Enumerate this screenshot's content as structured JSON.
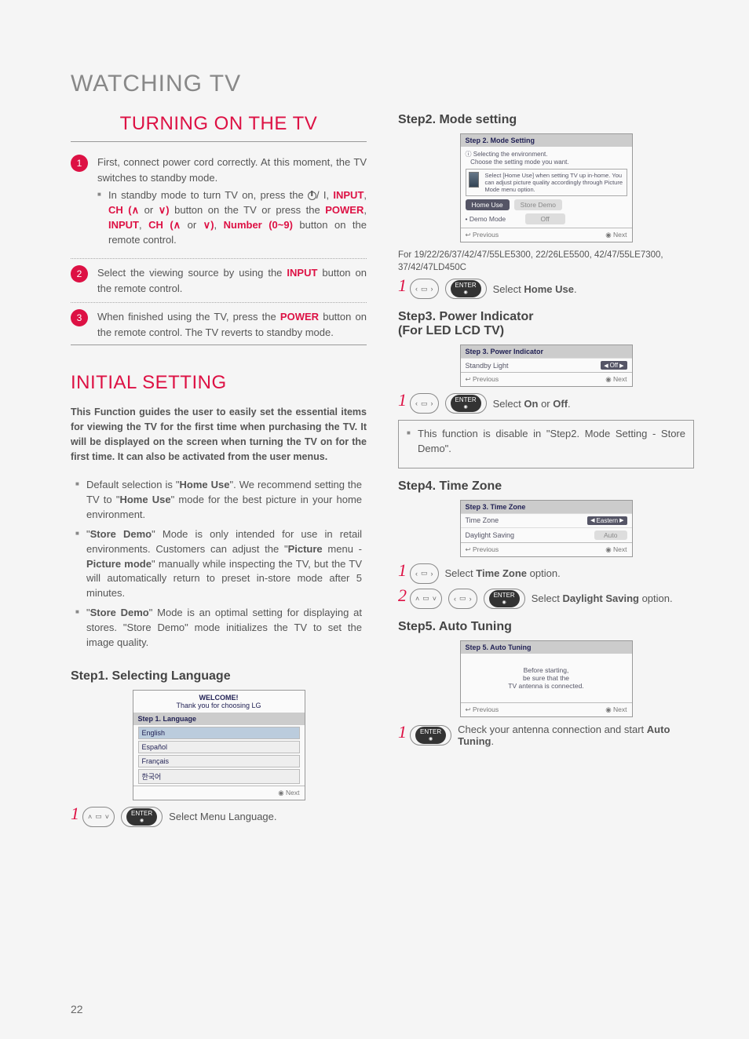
{
  "page": {
    "number": "22",
    "title": "WATCHING TV"
  },
  "turning_on": {
    "title": "TURNING ON THE TV",
    "s1": {
      "line1": "First, connect power cord correctly.",
      "line2": "At this moment, the TV switches to standby mode.",
      "bullet_pre": "In standby mode to turn TV on, press the ",
      "bullet_mid1": "/ I, ",
      "input": "INPUT",
      "comma1": ", ",
      "ch": "CH (",
      "up": "∧",
      "or": " or ",
      "down": "∨",
      "chclose": ")",
      "bullet_mid2": " button on the TV or press the ",
      "power": "POWER",
      "comma2": ", ",
      "num": "Number (0~9)",
      "bullet_end": " button on the remote control."
    },
    "s2": {
      "pre": "Select the viewing source by using the ",
      "input": "INPUT",
      "post": " button on the remote control."
    },
    "s3": {
      "pre": "When finished using the TV, press the ",
      "power": "POWER",
      "post": " button on the remote control. The TV reverts to standby mode."
    }
  },
  "initial": {
    "title": "INITIAL SETTING",
    "intro": "This Function guides the user to easily set the essential items for viewing the TV for the first time when purchasing the TV. It will be displayed on the screen when turning the TV on for the first time. It can also be activated from the user menus.",
    "b1_pre": "Default selection is \"",
    "home_use": "Home Use",
    "b1_mid": "\". We recommend setting the TV to \"",
    "b1_post": "\" mode for the best picture in your home environment.",
    "b2_pre": "\"",
    "store_demo": "Store Demo",
    "b2_mid": "\" Mode is only intended for use in retail environments. Customers can adjust the \"",
    "picture": "Picture",
    "b2_mid2": " menu - ",
    "picture_mode": "Picture mode",
    "b2_post": "\" manually while inspecting the TV, but the TV will automatically return to preset in-store mode after 5 minutes.",
    "b3_pre": "\"",
    "b3_post": "\" Mode is an optimal setting for displaying at stores. \"Store Demo\" mode initializes the TV to set the image quality."
  },
  "step1": {
    "title": "Step1. Selecting Language",
    "osd": {
      "welcome1": "WELCOME!",
      "welcome2": "Thank you for choosing LG",
      "header": "Step 1. Language",
      "opts": [
        "English",
        "Español",
        "Français",
        "한국어"
      ],
      "next": "Next"
    },
    "instr": "Select Menu Language."
  },
  "step2": {
    "title": "Step2. Mode setting",
    "osd": {
      "header": "Step 2. Mode Setting",
      "sub1": "Selecting the environment.",
      "sub2": "Choose the setting mode you want.",
      "desc": "Select [Home Use] when setting TV up in-home. You can adjust picture quality accordingly through Picture Mode menu option.",
      "home": "Home Use",
      "store": "Store Demo",
      "demo_label": "• Demo Mode",
      "off": "Off",
      "prev": "Previous",
      "next": "Next"
    },
    "models": "For 19/22/26/37/42/47/55LE5300, 22/26LE5500, 42/47/55LE7300, 37/42/47LD450C",
    "instr_pre": "Select ",
    "instr_b": "Home Use",
    "instr_post": "."
  },
  "step3": {
    "title1": "Step3. Power Indicator",
    "title2": "(For LED LCD TV)",
    "osd": {
      "header": "Step 3. Power Indicator",
      "label": "Standby Light",
      "val": "Off",
      "prev": "Previous",
      "next": "Next"
    },
    "instr_pre": "Select ",
    "on": "On",
    "or": " or ",
    "off": "Off",
    "instr_post": ".",
    "note": "This function is disable in \"Step2. Mode Setting - Store Demo\"."
  },
  "step4": {
    "title": "Step4. Time Zone",
    "osd": {
      "header": "Step 3. Time Zone",
      "tz_label": "Time Zone",
      "tz_val": "Eastern",
      "ds_label": "Daylight Saving",
      "ds_val": "Auto",
      "prev": "Previous",
      "next": "Next"
    },
    "i1_pre": "Select ",
    "i1_b": "Time Zone",
    "i1_post": " option.",
    "i2_pre": "Select ",
    "i2_b": "Daylight Saving",
    "i2_post": " option."
  },
  "step5": {
    "title": "Step5. Auto Tuning",
    "osd": {
      "header": "Step 5. Auto Tuning",
      "l1": "Before starting,",
      "l2": "be sure that the",
      "l3": "TV antenna is connected.",
      "prev": "Previous",
      "next": "Next"
    },
    "instr_pre": "Check your antenna connection and start ",
    "instr_b": "Auto Tuning",
    "instr_post": "."
  },
  "remote": {
    "enter": "ENTER"
  }
}
